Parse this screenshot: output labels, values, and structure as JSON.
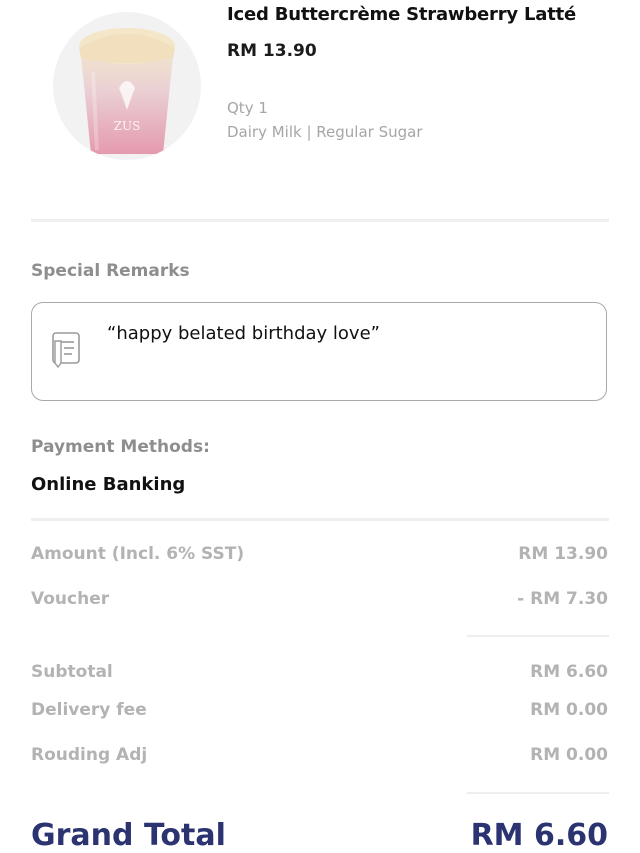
{
  "product": {
    "name": "Iced Buttercrème Strawberry Latté",
    "price": "RM 13.90",
    "qty": "Qty 1",
    "options": "Dairy Milk | Regular Sugar",
    "cup_logo": "ZUS",
    "image_icon": "iced-latte-cup-image"
  },
  "remarks": {
    "label": "Special Remarks",
    "text": "“happy belated birthday love”",
    "icon": "notepad-pencil-icon"
  },
  "payment": {
    "label": "Payment Methods:",
    "value": "Online Banking"
  },
  "summary": {
    "amount_label": "Amount (Incl. 6% SST)",
    "amount_value": "RM 13.90",
    "voucher_label": "Voucher",
    "voucher_value": "- RM 7.30",
    "subtotal_label": "Subtotal",
    "subtotal_value": "RM 6.60",
    "delivery_label": "Delivery fee",
    "delivery_value": "RM 0.00",
    "rounding_label": "Rouding Adj",
    "rounding_value": "RM 0.00",
    "grand_total_label": "Grand Total",
    "grand_total_value": "RM 6.60"
  },
  "colors": {
    "grand_total": "#2b3370",
    "muted_text": "#b3b3b3",
    "label_text": "#8e8e8e",
    "cup_pink": "#e8a7b6",
    "cup_foam": "#f3e4c4"
  }
}
